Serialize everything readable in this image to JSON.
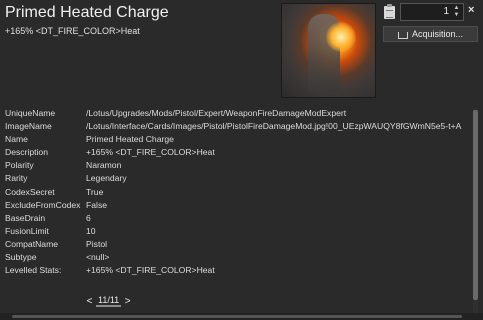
{
  "header": {
    "title": "Primed Heated Charge",
    "subtitle": "+165% <DT_FIRE_COLOR>Heat"
  },
  "toolbar": {
    "quantity_value": "1",
    "acquisition_label": "Acquisition...",
    "close_label": "×",
    "icons": [
      "clipboard-icon",
      "cart-icon",
      "close-icon",
      "spinner-arrows-icon"
    ]
  },
  "properties": [
    {
      "key": "UniqueName",
      "value": "/Lotus/Upgrades/Mods/Pistol/Expert/WeaponFireDamageModExpert"
    },
    {
      "key": "ImageName",
      "value": "/Lotus/Interface/Cards/Images/Pistol/PistolFireDamageMod.jpg!00_UEzpWAUQY8fGWmN5e5-t+A"
    },
    {
      "key": "Name",
      "value": "Primed Heated Charge"
    },
    {
      "key": "Description",
      "value": "+165% <DT_FIRE_COLOR>Heat"
    },
    {
      "key": "Polarity",
      "value": "Naramon"
    },
    {
      "key": "Rarity",
      "value": "Legendary"
    },
    {
      "key": "CodexSecret",
      "value": "True"
    },
    {
      "key": "ExcludeFromCodex",
      "value": "False"
    },
    {
      "key": "BaseDrain",
      "value": "6"
    },
    {
      "key": "FusionLimit",
      "value": "10"
    },
    {
      "key": "CompatName",
      "value": "Pistol"
    },
    {
      "key": "Subtype",
      "value": "<null>"
    },
    {
      "key": "Levelled Stats:",
      "value": "+165% <DT_FIRE_COLOR>Heat"
    }
  ],
  "pager": {
    "prev": "<",
    "label": "11/11",
    "next": ">"
  }
}
